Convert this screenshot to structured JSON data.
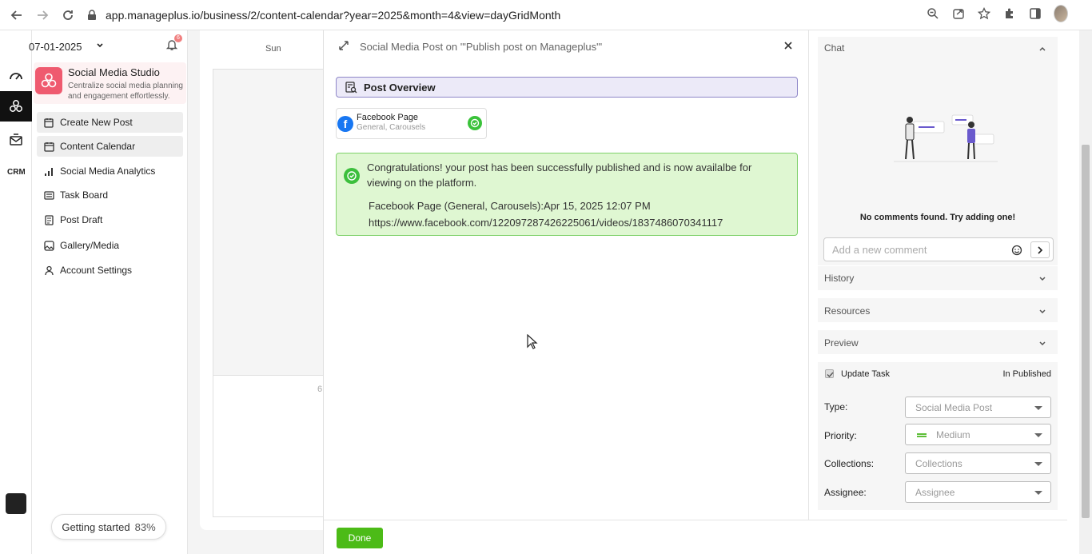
{
  "browser": {
    "url": "app.manageplus.io/business/2/content-calendar?year=2025&month=4&view=dayGridMonth"
  },
  "sidebar": {
    "date": "07-01-2025",
    "notification_count": "6",
    "studio_title": "Social Media Studio",
    "studio_subtitle": "Centralize social media planning and engagement effortlessly.",
    "items": [
      {
        "label": "Create New Post",
        "icon": "edit-calendar-icon"
      },
      {
        "label": "Content Calendar",
        "icon": "calendar-icon"
      },
      {
        "label": "Social Media Analytics",
        "icon": "bar-chart-icon"
      },
      {
        "label": "Task Board",
        "icon": "task-board-icon"
      },
      {
        "label": "Post Draft",
        "icon": "draft-icon"
      },
      {
        "label": "Gallery/Media",
        "icon": "gallery-icon"
      },
      {
        "label": "Account Settings",
        "icon": "user-icon"
      }
    ],
    "getting_started": "Getting started",
    "getting_started_pct": "83%"
  },
  "calendar": {
    "day_header": "Sun",
    "day_number": "6"
  },
  "modal": {
    "title": "Social Media Post on '\"Publish post on Manageplus\"'",
    "overview_label": "Post Overview",
    "fb_page_name": "Facebook Page",
    "fb_page_sub": "General, Carousels",
    "success_message": "Congratulations! your post has been successfully published and is now availalbe for viewing on the platform.",
    "success_line1": "Facebook Page (General, Carousels):Apr 15, 2025 12:07 PM",
    "success_line2": "https://www.facebook.com/122097287426225061/videos/1837486070341117",
    "done_label": "Done"
  },
  "right_panel": {
    "chat_title": "Chat",
    "no_comments": "No comments found. Try adding one!",
    "comment_placeholder": "Add a new comment",
    "history_title": "History",
    "resources_title": "Resources",
    "preview_title": "Preview",
    "update_task_label": "Update Task",
    "status": "In Published",
    "type_label": "Type:",
    "type_value": "Social Media Post",
    "priority_label": "Priority:",
    "priority_value": "Medium",
    "collections_label": "Collections:",
    "collections_placeholder": "Collections",
    "assignee_label": "Assignee:",
    "assignee_placeholder": "Assignee"
  },
  "colors": {
    "accent_green": "#4cbb17",
    "success_bg": "#dff7d2",
    "overview_bg": "#eceaf8",
    "brand_pink": "#ef5a6f",
    "facebook_blue": "#1877f2"
  }
}
